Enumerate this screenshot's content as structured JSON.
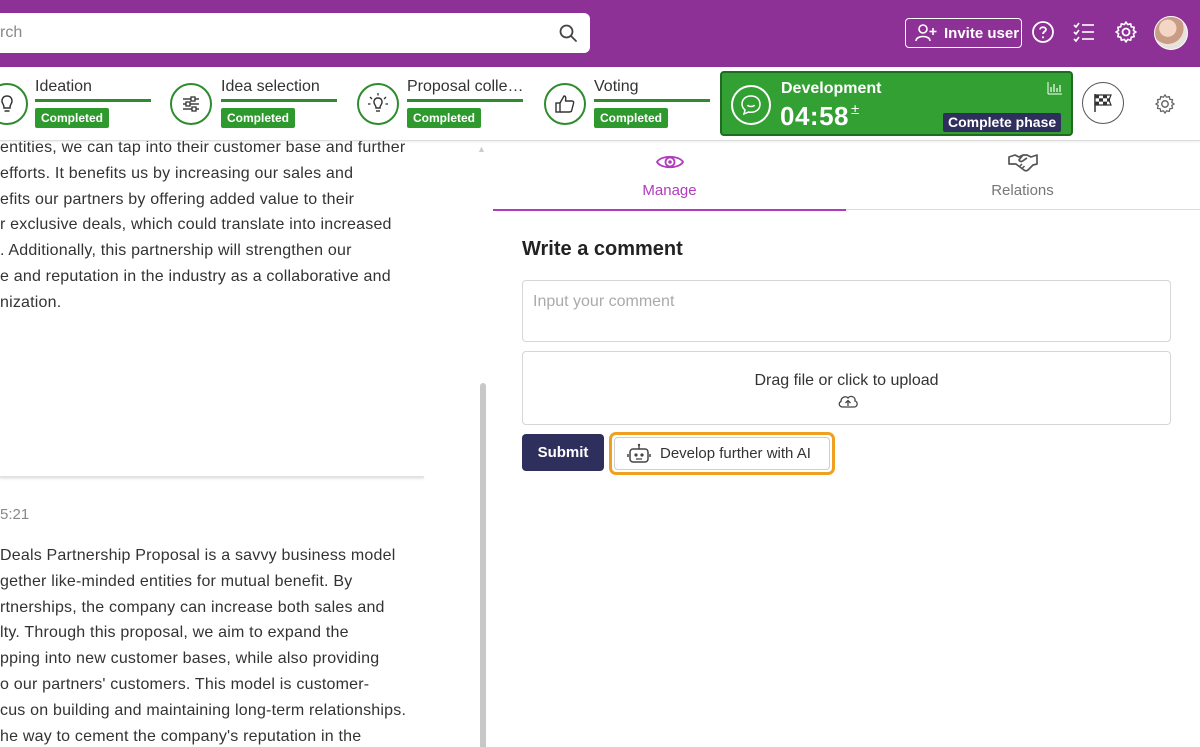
{
  "colors": {
    "brand_purple": "#8d3196",
    "completed_green": "#2e9a2e",
    "active_phase_green": "#33a033",
    "navy": "#2f2f5e",
    "tab_active": "#b23bbd",
    "highlight_orange": "#f0a020"
  },
  "topbar": {
    "search_placeholder": "rch",
    "invite_label": "Invite user",
    "icons": [
      "search-icon",
      "user-plus-icon",
      "help-icon",
      "checklist-icon",
      "gear-icon",
      "avatar"
    ]
  },
  "stages": [
    {
      "name": "Ideation",
      "status": "Completed",
      "icon": "bulb-icon"
    },
    {
      "name": "Idea selection",
      "status": "Completed",
      "icon": "sliders-icon"
    },
    {
      "name": "Proposal colle…",
      "status": "Completed",
      "icon": "lightbulb-icon"
    },
    {
      "name": "Voting",
      "status": "Completed",
      "icon": "thumbs-up-icon"
    }
  ],
  "active_stage": {
    "name": "Development",
    "timer": "04:58",
    "timer_adjust": "±",
    "complete_label": "Complete phase",
    "icon": "chat-smile-icon"
  },
  "left": {
    "paragraph1": [
      "entities, we can tap into their customer base and further",
      "efforts. It benefits us by increasing our sales and",
      "efits our partners by offering added value to their",
      "r exclusive deals, which could translate into increased",
      ". Additionally, this partnership will strengthen our",
      "e and reputation in the industry as a collaborative and",
      "nization."
    ],
    "timestamp": "5:21",
    "paragraph2": [
      "Deals Partnership Proposal is a savvy business model",
      "gether like-minded entities for mutual benefit. By",
      "rtnerships, the company can increase both sales and",
      "lty. Through this proposal, we aim to expand the",
      "pping into new customer bases, while also providing",
      "o our partners' customers. This model is customer-",
      "cus on building and maintaining long-term relationships.",
      "he way to cement the company's reputation in the"
    ]
  },
  "tabs": [
    {
      "label": "Manage",
      "active": true
    },
    {
      "label": "Relations",
      "active": false
    }
  ],
  "comment": {
    "title": "Write a comment",
    "placeholder": "Input your comment",
    "upload_text": "Drag file or click to upload",
    "submit_label": "Submit",
    "ai_label": "Develop further with AI"
  }
}
